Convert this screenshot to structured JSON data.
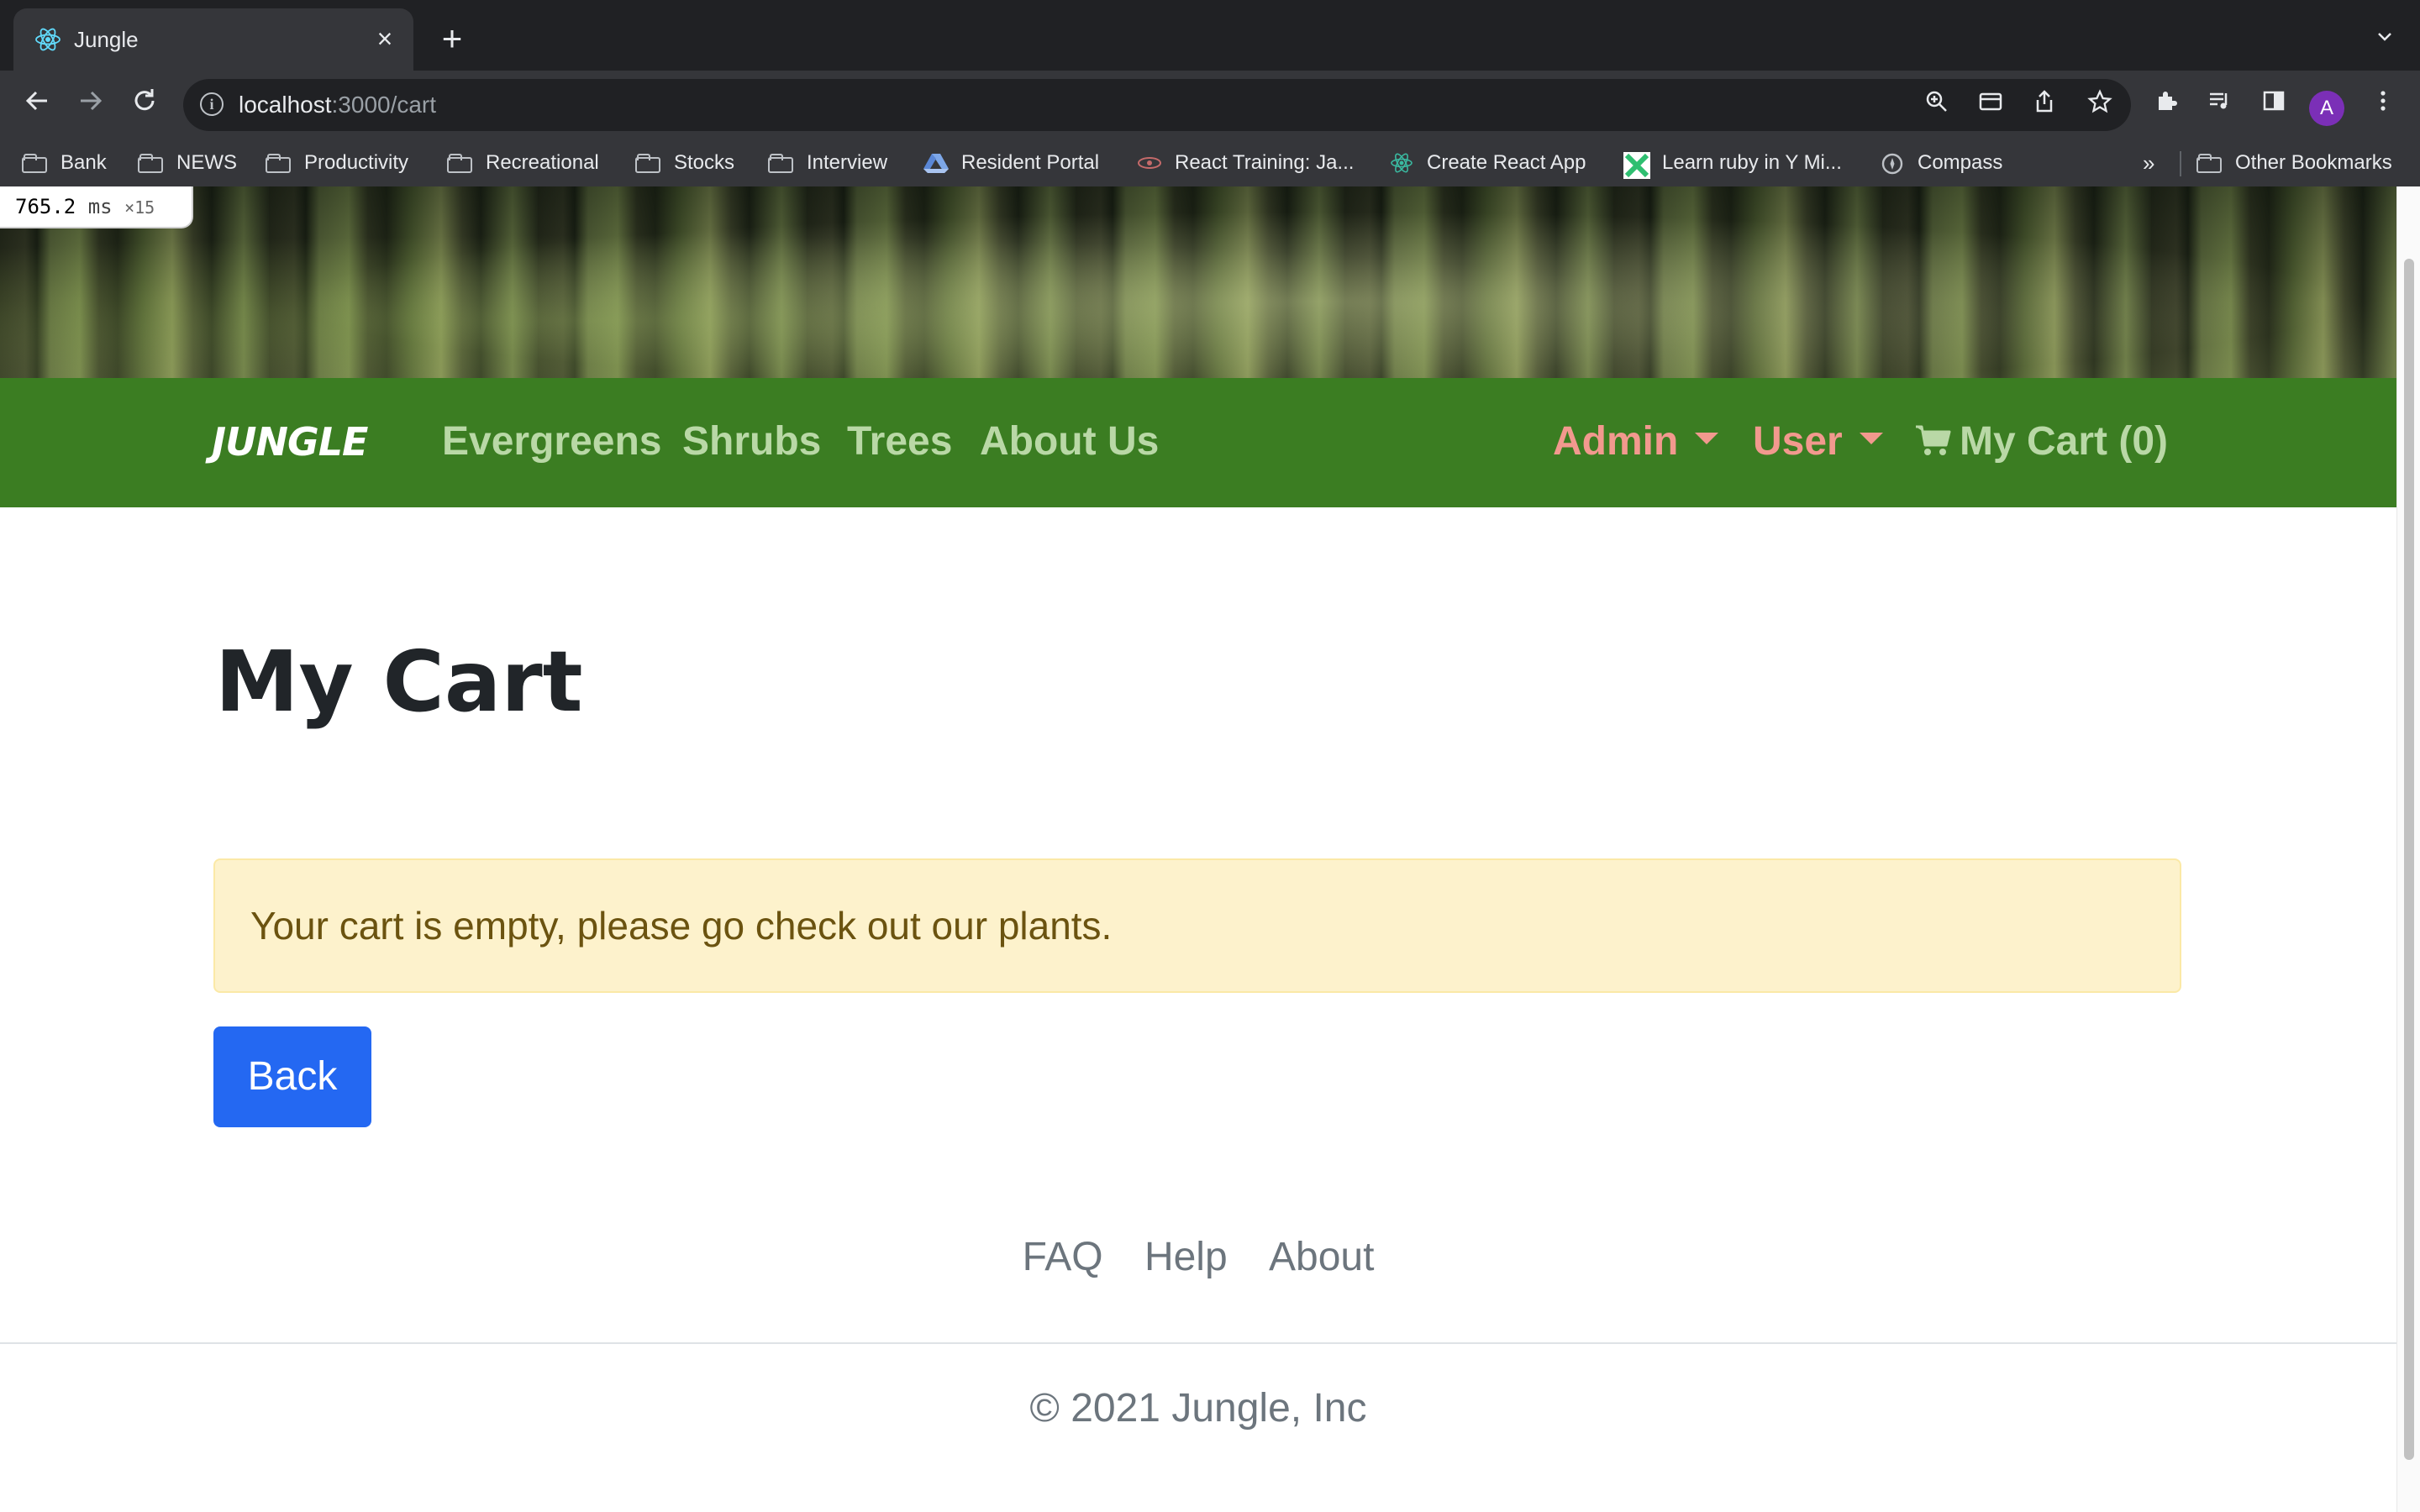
{
  "browser": {
    "tab": {
      "title": "Jungle"
    },
    "url": {
      "host": "localhost",
      "path": ":3000/cart"
    },
    "bookmarks": [
      {
        "label": "Bank",
        "icon": "folder-icon"
      },
      {
        "label": "NEWS",
        "icon": "folder-icon"
      },
      {
        "label": "Productivity",
        "icon": "folder-icon"
      },
      {
        "label": "Recreational",
        "icon": "folder-icon"
      },
      {
        "label": "Stocks",
        "icon": "folder-icon"
      },
      {
        "label": "Interview",
        "icon": "folder-icon"
      },
      {
        "label": "Resident Portal",
        "icon": "drive-icon"
      },
      {
        "label": "React Training: Ja...",
        "icon": "react-training-icon"
      },
      {
        "label": "Create React App",
        "icon": "react-icon"
      },
      {
        "label": "Learn ruby in Y Mi...",
        "icon": "learnx-icon"
      },
      {
        "label": "Compass",
        "icon": "compass-icon"
      }
    ],
    "bookmarks_overflow": "»",
    "other_bookmarks": "Other Bookmarks",
    "profile_initial": "A"
  },
  "perf_badge": {
    "value": "765.2",
    "unit": "ms",
    "multiplier": "×15"
  },
  "site": {
    "brand": "JUNGLE",
    "nav": [
      "Evergreens",
      "Shrubs",
      "Trees",
      "About Us"
    ],
    "admin_label": "Admin",
    "user_label": "User",
    "cart_label": "My Cart (0)"
  },
  "main": {
    "title": "My Cart",
    "alert": "Your cart is empty, please go check out our plants.",
    "back_label": "Back"
  },
  "footer": {
    "links": [
      "FAQ",
      "Help",
      "About"
    ],
    "copyright": "© 2021 Jungle, Inc"
  },
  "colors": {
    "navbar": "#3b7d22",
    "nav_link": "#b9d8a6",
    "dropdown_link": "#f2998e",
    "alert_bg": "#fdf2cc",
    "primary_button": "#2468f2"
  }
}
